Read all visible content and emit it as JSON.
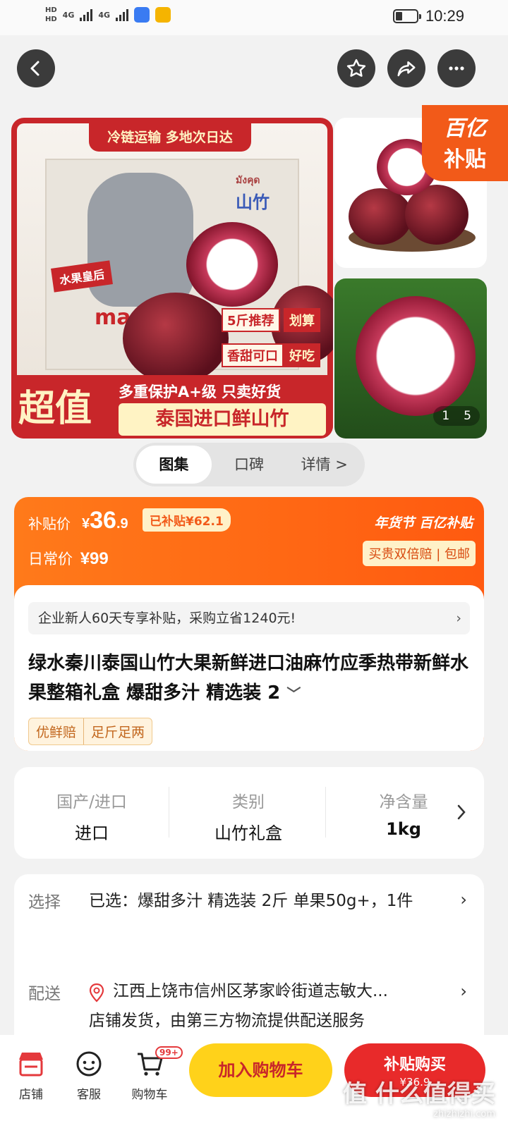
{
  "status_bar": {
    "hd1": "HD",
    "hd2": "HD",
    "net1": "4G",
    "net2": "4G",
    "time": "10:29"
  },
  "nav": {
    "back_icon": "chevron-left-icon",
    "fav_icon": "star-icon",
    "share_icon": "share-arrow-icon",
    "more_icon": "more-dots-icon"
  },
  "gallery": {
    "banner_top": "冷链运输 多地次日达",
    "brand_thai": "มังคุด",
    "brand_cn": "山竹",
    "queen_tag": "水果皇后",
    "box_text": "ma",
    "pill1": "5斤推荐",
    "pill1b": "划算",
    "pill2": "香甜可口",
    "pill2b": "好吃",
    "big_label": "超值",
    "band_line1": "多重保护A+级 只卖好货",
    "band_line2": "泰国进口鲜山竹",
    "subsidy_l1": "百亿",
    "subsidy_l2": "补贴",
    "counter_current": "1",
    "counter_total": "5"
  },
  "tabs": [
    "图集",
    "口碑",
    "详情 >"
  ],
  "price": {
    "subsidy_label": "补贴价",
    "currency": "¥",
    "int": "36",
    "dec": ".9",
    "saved_tag": "已补贴¥62.1",
    "regular_label": "日常价",
    "regular_value": "¥99",
    "brand_right": "年货节 百亿补贴",
    "guarantee": "买贵双倍赔 | 包邮"
  },
  "promo": {
    "text": "企业新人60天专享补贴，采购立省1240元!",
    "chevron": "›"
  },
  "product": {
    "title": "绿水秦川泰国山竹大果新鲜进口油麻竹应季热带新鲜水果整箱礼盒 爆甜多汁 精选装 2",
    "expand": "﹀",
    "tags": [
      "优鲜赔",
      "足斤足两"
    ]
  },
  "attributes": [
    {
      "key": "国产/进口",
      "value": "进口"
    },
    {
      "key": "类别",
      "value": "山竹礼盒"
    },
    {
      "key": "净含量",
      "value": "1kg"
    }
  ],
  "options": {
    "select_label": "选择",
    "select_text": "已选：爆甜多汁 精选装 2斤 单果50g+，1件",
    "delivery_label": "配送",
    "delivery_address": "江西上饶市信州区茅家岭街道志敏大...",
    "delivery_note": "店铺发货，由第三方物流提供配送服务",
    "chevron": "›"
  },
  "bottom_bar": {
    "shop": "店铺",
    "service": "客服",
    "cart": "购物车",
    "cart_badge": "99+",
    "add_to_cart": "加入购物车",
    "buy_now": "补贴购买",
    "buy_price": "¥36.9"
  },
  "watermark": {
    "main": "值 什么值得买",
    "sub": "zhizhizhi.com"
  },
  "colors": {
    "accent": "#ff5a10",
    "red": "#e82a2a",
    "yellow": "#ffd21a"
  }
}
